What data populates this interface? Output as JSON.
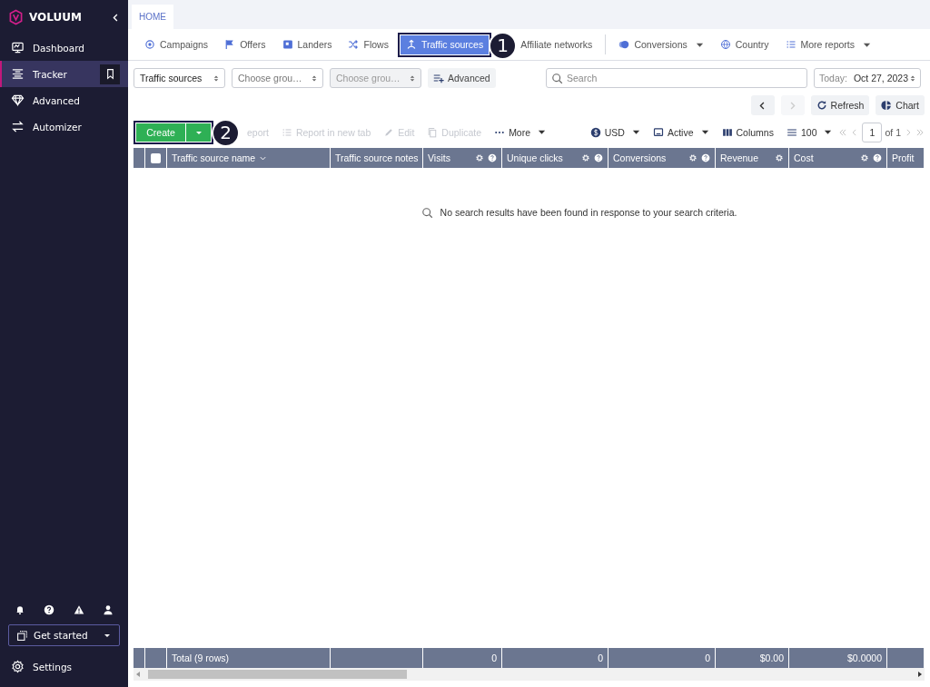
{
  "sidebar": {
    "logo": "VOLUUM",
    "items": [
      {
        "label": "Dashboard",
        "selected": false
      },
      {
        "label": "Tracker",
        "selected": true
      },
      {
        "label": "Advanced",
        "selected": false
      },
      {
        "label": "Automizer",
        "selected": false
      }
    ],
    "get_started": "Get started",
    "settings": "Settings"
  },
  "tabs": [
    {
      "label": "HOME",
      "selected": true
    }
  ],
  "nav": [
    {
      "label": "Campaigns",
      "selected": false
    },
    {
      "label": "Offers",
      "selected": false
    },
    {
      "label": "Landers",
      "selected": false
    },
    {
      "label": "Flows",
      "selected": false
    },
    {
      "label": "Traffic sources",
      "selected": true,
      "callout": "1"
    },
    {
      "label": "Affiliate networks",
      "selected": false
    },
    {
      "label": "Conversions",
      "selected": false
    },
    {
      "label": "Country",
      "selected": false
    },
    {
      "label": "More reports",
      "selected": false
    }
  ],
  "filters": [
    {
      "value": "Traffic sources",
      "disabled": false
    },
    {
      "placeholder": "Choose grou…",
      "disabled": false
    },
    {
      "placeholder": "Choose grou…",
      "disabled": true
    }
  ],
  "advanced": "Advanced",
  "search": {
    "placeholder": "Search"
  },
  "date": {
    "label": "Today:",
    "value": "Oct 27, 2023"
  },
  "history": {
    "back_disabled": false,
    "forward_disabled": true
  },
  "refresh": "Refresh",
  "chart": "Chart",
  "create": {
    "label": "Create",
    "callout": "2"
  },
  "actions": [
    {
      "label": "eport",
      "disabled": true
    },
    {
      "label": "Report in new tab",
      "disabled": true
    },
    {
      "label": "Edit",
      "disabled": true
    },
    {
      "label": "Duplicate",
      "disabled": true
    },
    {
      "label": "More",
      "disabled": false
    }
  ],
  "options": [
    {
      "label": "USD"
    },
    {
      "label": "Active"
    },
    {
      "label": "Columns"
    },
    {
      "label": "100"
    }
  ],
  "pagination": {
    "page": "1",
    "of": "of 1"
  },
  "table": {
    "select_all": {
      "checked": false
    },
    "columns": [
      {
        "label": "Traffic source name"
      },
      {
        "label": "Traffic source notes"
      },
      {
        "label": "Visits"
      },
      {
        "label": "Unique clicks"
      },
      {
        "label": "Conversions"
      },
      {
        "label": "Revenue"
      },
      {
        "label": "Cost"
      },
      {
        "label": "Profit"
      }
    ],
    "empty_message": "No search results have been found in response to your search criteria.",
    "footer": {
      "total": "Total (9 rows)",
      "visits": "0",
      "unique_clicks": "0",
      "conversions": "0",
      "revenue": "$0.00",
      "cost": "$0.0000"
    }
  }
}
